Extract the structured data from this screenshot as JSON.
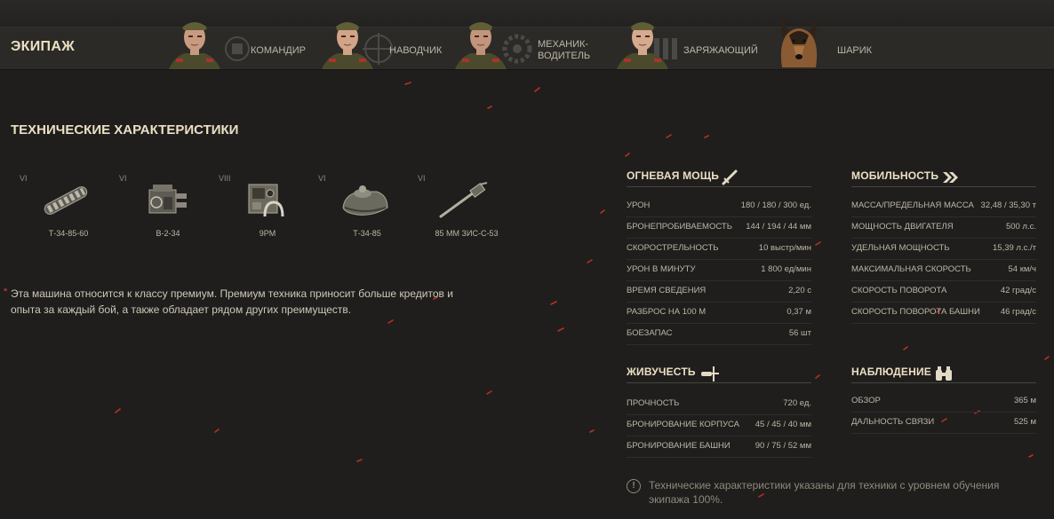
{
  "crew": {
    "title": "ЭКИПАЖ",
    "members": [
      {
        "role": "КОМАНДИР"
      },
      {
        "role": "НАВОДЧИК"
      },
      {
        "role": "МЕХАНИК-\nВОДИТЕЛЬ",
        "role_line1": "МЕХАНИК-",
        "role_line2": "ВОДИТЕЛЬ"
      },
      {
        "role": "ЗАРЯЖАЮЩИЙ"
      },
      {
        "role": "ШАРИК"
      }
    ]
  },
  "specs": {
    "title": "ТЕХНИЧЕСКИЕ ХАРАКТЕРИСТИКИ",
    "modules": [
      {
        "tier": "VI",
        "name": "Т-34-85-60",
        "icon": "tracks-icon"
      },
      {
        "tier": "VI",
        "name": "В-2-34",
        "icon": "engine-icon"
      },
      {
        "tier": "VIII",
        "name": "9РМ",
        "icon": "radio-icon"
      },
      {
        "tier": "VI",
        "name": "Т-34-85",
        "icon": "turret-icon"
      },
      {
        "tier": "VI",
        "name": "85 ММ ЗИС-С-53",
        "icon": "gun-icon"
      }
    ],
    "premium_note": "Эта машина относится к классу премиум. Премиум техника приносит больше кредитов и опыта за каждый бой, а также обладает рядом других преимуществ.",
    "premium_star": "*"
  },
  "firepower": {
    "title": "ОГНЕВАЯ МОЩЬ",
    "icon": "sword-icon",
    "rows": [
      {
        "label": "УРОН",
        "value": "180 / 180 / 300 ед."
      },
      {
        "label": "БРОНЕПРОБИВАЕМОСТЬ",
        "value": "144 / 194 / 44 мм"
      },
      {
        "label": "СКОРОСТРЕЛЬНОСТЬ",
        "value": "10 выстр/мин"
      },
      {
        "label": "УРОН В МИНУТУ",
        "value": "1 800 ед/мин"
      },
      {
        "label": "ВРЕМЯ СВЕДЕНИЯ",
        "value": "2,20 с"
      },
      {
        "label": "РАЗБРОС НА 100 М",
        "value": "0,37 м"
      },
      {
        "label": "БОЕЗАПАС",
        "value": "56 шт"
      }
    ]
  },
  "survivability": {
    "title": "ЖИВУЧЕСТЬ",
    "icon": "repair-icon",
    "rows": [
      {
        "label": "ПРОЧНОСТЬ",
        "value": "720 ед."
      },
      {
        "label": "БРОНИРОВАНИЕ КОРПУСА",
        "value": "45 / 45 / 40 мм"
      },
      {
        "label": "БРОНИРОВАНИЕ БАШНИ",
        "value": "90 / 75 / 52 мм"
      }
    ]
  },
  "mobility": {
    "title": "МОБИЛЬНОСТЬ",
    "icon": "double-chevron-icon",
    "rows": [
      {
        "label": "МАССА/ПРЕДЕЛЬНАЯ МАССА",
        "value": "32,48 / 35,30 т"
      },
      {
        "label": "МОЩНОСТЬ ДВИГАТЕЛЯ",
        "value": "500 л.с."
      },
      {
        "label": "УДЕЛЬНАЯ МОЩНОСТЬ",
        "value": "15,39 л.с./т"
      },
      {
        "label": "МАКСИМАЛЬНАЯ СКОРОСТЬ",
        "value": "54 км/ч"
      },
      {
        "label": "СКОРОСТЬ ПОВОРОТА",
        "value": "42 град/с"
      },
      {
        "label": "СКОРОСТЬ ПОВОРОТА БАШНИ",
        "value": "46 град/с"
      }
    ]
  },
  "observation": {
    "title": "НАБЛЮДЕНИЕ",
    "icon": "binoculars-icon",
    "rows": [
      {
        "label": "ОБЗОР",
        "value": "365 м"
      },
      {
        "label": "ДАЛЬНОСТЬ СВЯЗИ",
        "value": "525 м"
      }
    ]
  },
  "footnote": {
    "icon_glyph": "!",
    "text": "Технические характеристики указаны для техники с уровнем обучения экипажа 100%."
  }
}
